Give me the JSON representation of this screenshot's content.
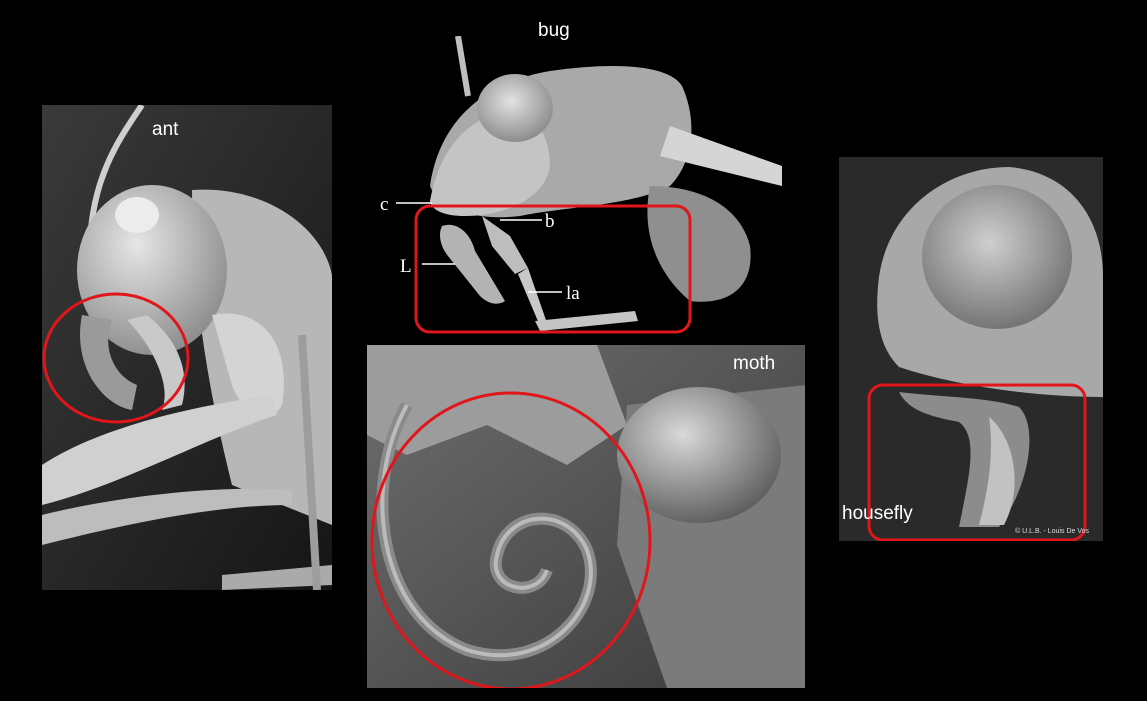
{
  "colors": {
    "background": "#000000",
    "highlight": "#e0161b",
    "micrograph": "#8a8a8a"
  },
  "panels": {
    "ant": {
      "title": "ant"
    },
    "bug": {
      "title": "bug",
      "parts": {
        "c": "c",
        "b": "b",
        "L": "L",
        "la": "la"
      }
    },
    "moth": {
      "title": "moth"
    },
    "housefly": {
      "title": "housefly",
      "credit": "© U.L.B. - Louis De Vos"
    }
  }
}
